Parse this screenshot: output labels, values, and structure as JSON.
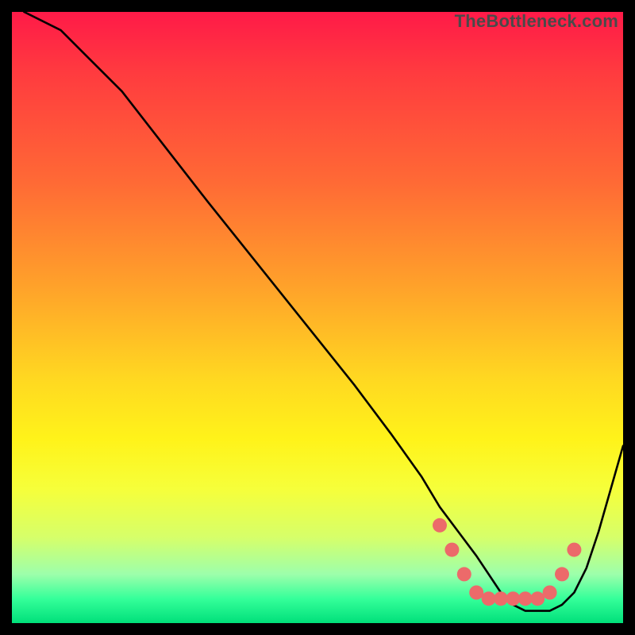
{
  "watermark": "TheBottleneck.com",
  "chart_data": {
    "type": "line",
    "title": "",
    "xlabel": "",
    "ylabel": "",
    "xlim": [
      0,
      100
    ],
    "ylim": [
      0,
      100
    ],
    "series": [
      {
        "name": "curve",
        "x": [
          2,
          8,
          12,
          18,
          25,
          32,
          40,
          48,
          56,
          62,
          67,
          70,
          73,
          76,
          78,
          80,
          82,
          84,
          86,
          88,
          90,
          92,
          94,
          96,
          98,
          100
        ],
        "values": [
          100,
          97,
          93,
          87,
          78,
          69,
          59,
          49,
          39,
          31,
          24,
          19,
          15,
          11,
          8,
          5,
          3,
          2,
          2,
          2,
          3,
          5,
          9,
          15,
          22,
          29
        ]
      }
    ],
    "markers": {
      "name": "dots",
      "x": [
        70,
        72,
        74,
        76,
        78,
        80,
        82,
        84,
        86,
        88,
        90,
        92
      ],
      "values": [
        16,
        12,
        8,
        5,
        4,
        4,
        4,
        4,
        4,
        5,
        8,
        12
      ],
      "color": "#ec6a6a",
      "radius_px": 9
    },
    "gradient_stops": [
      {
        "pos": 0.0,
        "color": "#ff1a48"
      },
      {
        "pos": 0.1,
        "color": "#ff3b3f"
      },
      {
        "pos": 0.28,
        "color": "#ff6a35"
      },
      {
        "pos": 0.45,
        "color": "#ffa22a"
      },
      {
        "pos": 0.6,
        "color": "#ffd821"
      },
      {
        "pos": 0.7,
        "color": "#fff31a"
      },
      {
        "pos": 0.78,
        "color": "#f6ff3a"
      },
      {
        "pos": 0.86,
        "color": "#d6ff6a"
      },
      {
        "pos": 0.92,
        "color": "#9dffab"
      },
      {
        "pos": 0.96,
        "color": "#35ff9a"
      },
      {
        "pos": 1.0,
        "color": "#00e07a"
      }
    ]
  }
}
